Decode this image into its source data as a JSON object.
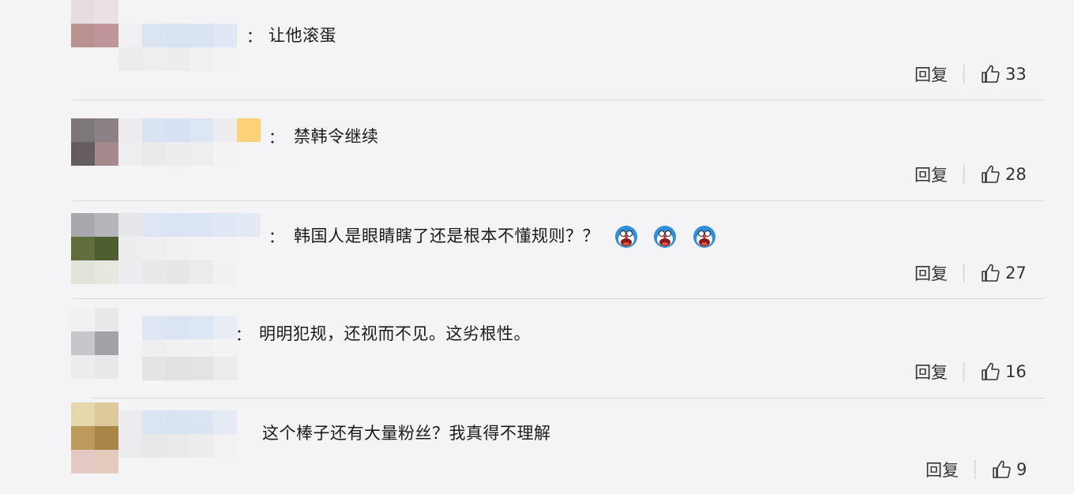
{
  "comments": [
    {
      "colon": "：",
      "text": "让他滚蛋",
      "reply_label": "回复",
      "likes": "33"
    },
    {
      "colon": "：",
      "text": "禁韩令继续",
      "reply_label": "回复",
      "likes": "28"
    },
    {
      "colon": "：",
      "text": "韩国人是眼睛瞎了还是根本不懂规则？？",
      "reply_label": "回复",
      "likes": "27",
      "emoji_count": 3
    },
    {
      "colon": "：",
      "text": "明明犯规，还视而不见。这劣根性。",
      "reply_label": "回复",
      "likes": "16"
    },
    {
      "colon": "",
      "text": "这个棒子还有大量粉丝？我真得不理解",
      "reply_label": "回复",
      "likes": "9"
    }
  ],
  "icons": {
    "like": "thumbs-up-icon",
    "emoji": "doraemon-emoji-icon"
  },
  "colors": {
    "background": "#f4f4f6",
    "divider": "#dadada",
    "text": "#1b1b1b"
  }
}
